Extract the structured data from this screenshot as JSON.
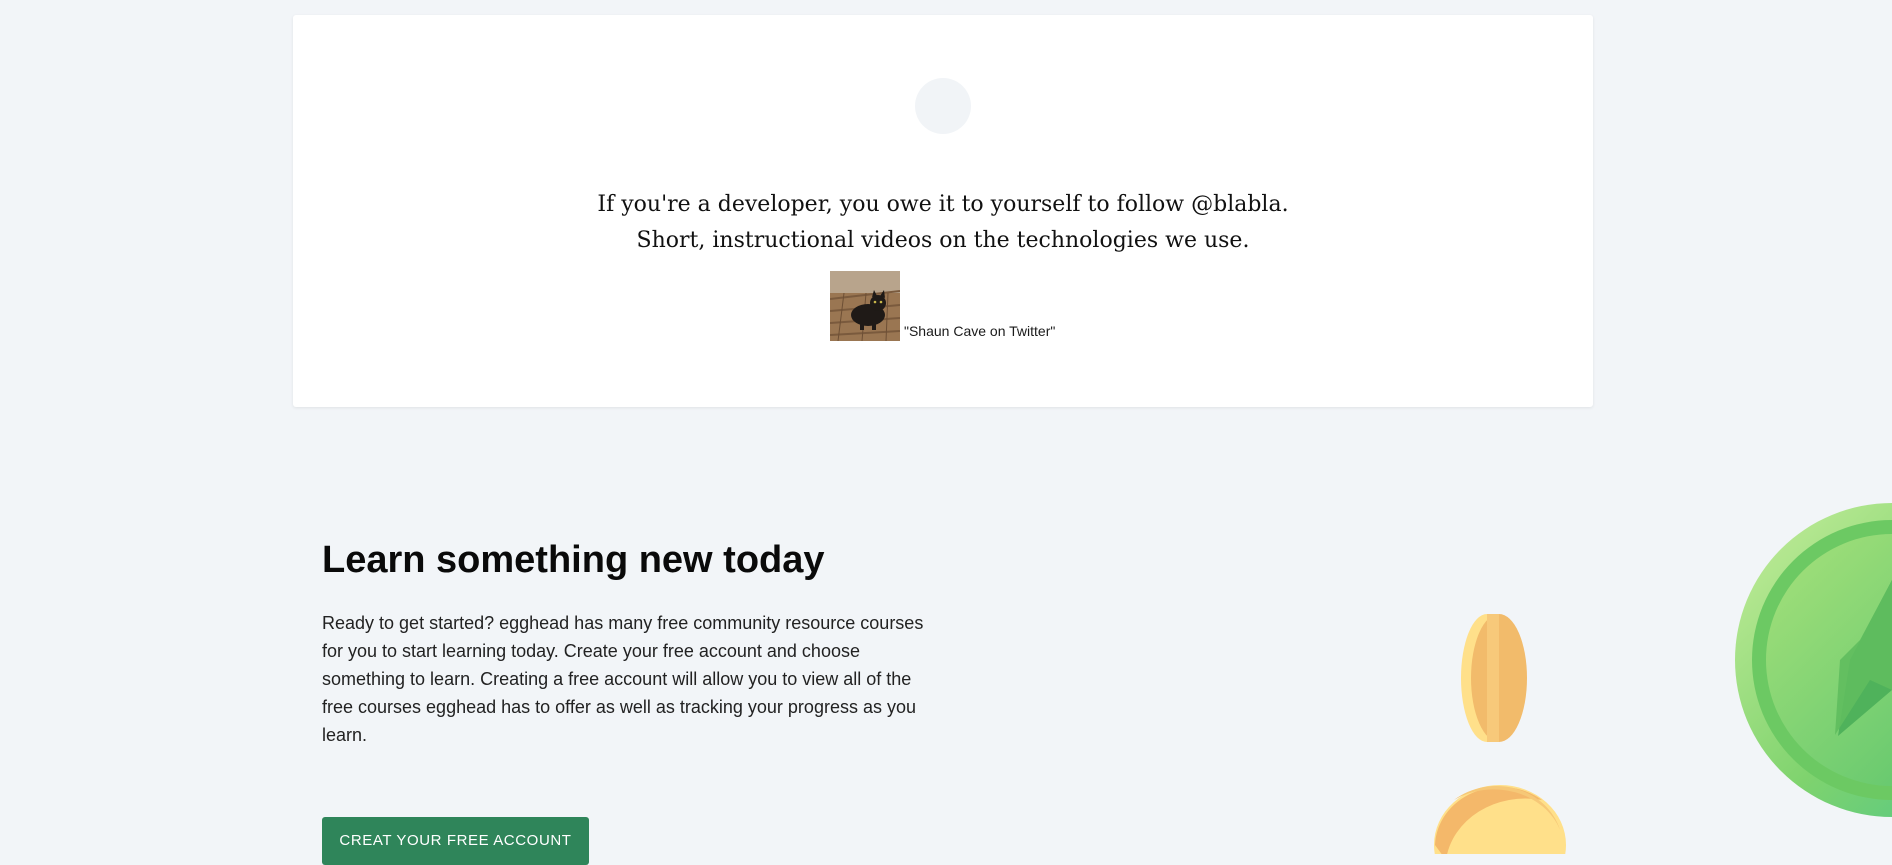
{
  "testimonial": {
    "quote": "If you're a developer, you owe it to yourself to follow @blabla. Short, instructional videos on the technologies we use.",
    "author": "\"Shaun Cave on Twitter\"",
    "author_photo_alt": "Shaun Cave"
  },
  "cta": {
    "title": "Learn something new today",
    "body": "Ready to get started? egghead has many free community resource courses for you to start learning today. Create your free account and choose something to learn. Creating a free account will allow you to view all of the free courses egghead has to offer as well as tracking your progress as you learn.",
    "button_label": "CREAT YOUR FREE ACCOUNT"
  },
  "colors": {
    "page_background": "#f2f5f8",
    "card_background": "#ffffff",
    "button_background": "#2f855a",
    "button_text": "#ffffff",
    "coin_gold": "#ffe08a",
    "coin_green": "#68d37a"
  },
  "icons": {
    "avatar_placeholder": "avatar-placeholder",
    "gold_coin": "gold-coin-icon",
    "green_star_coin": "star-coin-icon"
  }
}
